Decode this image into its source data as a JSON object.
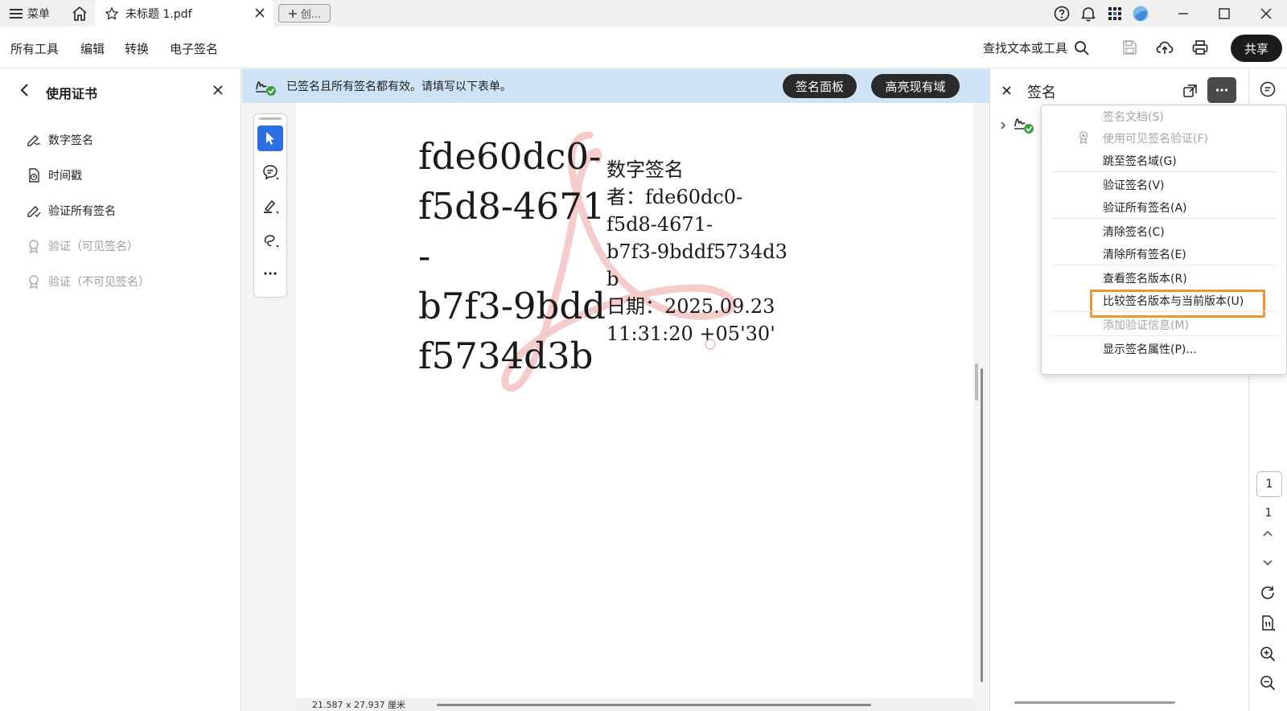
{
  "titlebar": {
    "menu_label": "菜单",
    "tab_title": "未标题 1.pdf",
    "new_tab_label": "创..."
  },
  "menubar": {
    "items": [
      "所有工具",
      "编辑",
      "转换",
      "电子签名"
    ],
    "find_label": "查找文本或工具",
    "share_label": "共享"
  },
  "left_panel": {
    "title": "使用证书",
    "items": [
      {
        "label": "数字签名",
        "icon": "digital-sign-icon",
        "enabled": true
      },
      {
        "label": "时间戳",
        "icon": "timestamp-icon",
        "enabled": true
      },
      {
        "label": "验证所有签名",
        "icon": "validate-sign-icon",
        "enabled": true
      },
      {
        "label": "验证（可见签名）",
        "icon": "certificate-icon",
        "enabled": false
      },
      {
        "label": "验证（不可见签名）",
        "icon": "certificate-icon",
        "enabled": false
      }
    ]
  },
  "banner": {
    "text": "已签名且所有签名都有效。请填写以下表单。",
    "signature_panel_button": "签名面板",
    "highlight_fields_button": "高亮现有域"
  },
  "document": {
    "sig_name_lines": [
      "fde60dc0-",
      "f5d8-4671",
      "-",
      "b7f3-9bdd",
      "f5734d3b"
    ],
    "sig_detail_lines": [
      "数字签名",
      "者：fde60dc0-",
      "f5d8-4671-",
      "b7f3-9bddf5734d3",
      "b",
      "日期：2025.09.23",
      "11:31:20 +05'30'"
    ],
    "dimensions": "21.587 x 27.937 厘米"
  },
  "signature_panel": {
    "title": "签名"
  },
  "dropdown_menu": {
    "items": [
      {
        "label": "签名文档(S)",
        "enabled": false
      },
      {
        "label": "使用可见签名验证(F)",
        "enabled": false
      },
      {
        "label": "跳至签名域(G)",
        "enabled": true
      },
      {
        "label": "验证签名(V)",
        "enabled": true
      },
      {
        "label": "验证所有签名(A)",
        "enabled": true
      },
      {
        "label": "清除签名(C)",
        "enabled": true
      },
      {
        "label": "清除所有签名(E)",
        "enabled": true
      },
      {
        "label": "查看签名版本(R)",
        "enabled": true
      },
      {
        "label": "比较签名版本与当前版本(U)",
        "enabled": true,
        "highlighted": true
      },
      {
        "label": "添加验证信息(M)",
        "enabled": false
      },
      {
        "label": "显示签名属性(P)...",
        "enabled": true
      }
    ]
  },
  "page_nav": {
    "current": "1",
    "total": "1"
  },
  "colors": {
    "accent_blue": "#2d6fe0",
    "banner_bg": "#cfe3f6",
    "highlight_orange": "#f0962e",
    "valid_green": "#3aa043"
  }
}
